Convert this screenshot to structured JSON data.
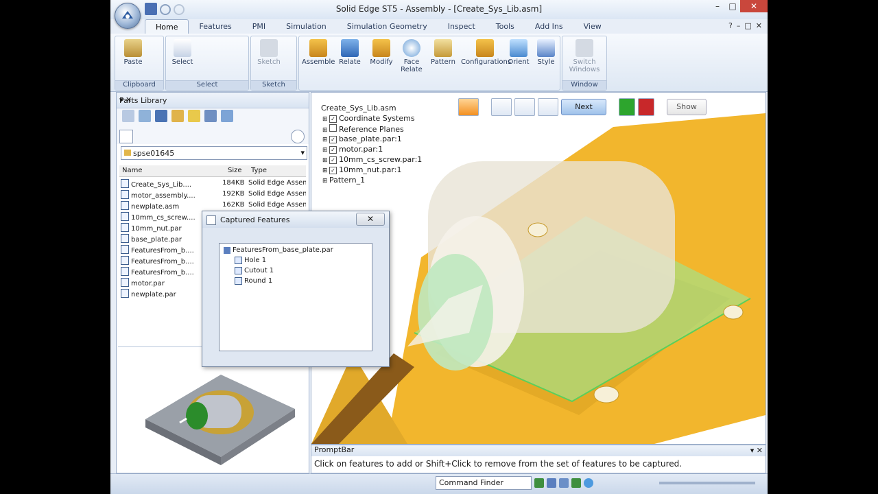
{
  "window": {
    "title": "Solid Edge ST5 - Assembly - [Create_Sys_Lib.asm]",
    "controls": [
      "–",
      "□",
      "✕"
    ]
  },
  "tabs": [
    "Home",
    "Features",
    "PMI",
    "Simulation",
    "Simulation Geometry",
    "Inspect",
    "Tools",
    "Add Ins",
    "View"
  ],
  "ribbon": {
    "groups": [
      "Clipboard",
      "Select",
      "Sketch",
      "Window"
    ],
    "buttons": {
      "paste": "Paste",
      "select": "Select",
      "sketch": "Sketch",
      "assemble": "Assemble",
      "relate": "Relate",
      "modify": "Modify",
      "face_relate": "Face Relate",
      "pattern": "Pattern",
      "configurations": "Configurations",
      "orient": "Orient",
      "style": "Style",
      "switch_windows": "Switch Windows"
    },
    "right_controls": [
      "?",
      "–",
      "□",
      "✕"
    ]
  },
  "parts_library": {
    "title": "Parts Library",
    "folder": "spse01645",
    "columns": {
      "name": "Name",
      "size": "Size",
      "type": "Type"
    },
    "files": [
      {
        "name": "Create_Sys_Lib....",
        "size": "184KB",
        "type": "Solid Edge Assem"
      },
      {
        "name": "motor_assembly....",
        "size": "192KB",
        "type": "Solid Edge Assem"
      },
      {
        "name": "newplate.asm",
        "size": "162KB",
        "type": "Solid Edge Assem"
      },
      {
        "name": "10mm_cs_screw....",
        "size": "",
        "type": ""
      },
      {
        "name": "10mm_nut.par",
        "size": "",
        "type": ""
      },
      {
        "name": "base_plate.par",
        "size": "",
        "type": ""
      },
      {
        "name": "FeaturesFrom_b....",
        "size": "",
        "type": ""
      },
      {
        "name": "FeaturesFrom_b....",
        "size": "",
        "type": ""
      },
      {
        "name": "FeaturesFrom_b....",
        "size": "",
        "type": ""
      },
      {
        "name": "motor.par",
        "size": "",
        "type": ""
      },
      {
        "name": "newplate.par",
        "size": "",
        "type": ""
      }
    ]
  },
  "pathfinder": {
    "items": [
      {
        "label": "Create_Sys_Lib.asm",
        "indent": 0,
        "checked": null
      },
      {
        "label": "Coordinate Systems",
        "indent": 1,
        "checked": true
      },
      {
        "label": "Reference Planes",
        "indent": 1,
        "checked": false
      },
      {
        "label": "base_plate.par:1",
        "indent": 1,
        "checked": true
      },
      {
        "label": "motor.par:1",
        "indent": 1,
        "checked": true
      },
      {
        "label": "10mm_cs_screw.par:1",
        "indent": 1,
        "checked": true
      },
      {
        "label": "10mm_nut.par:1",
        "indent": 1,
        "checked": true
      },
      {
        "label": "Pattern_1",
        "indent": 1,
        "checked": null
      }
    ]
  },
  "command_bar": {
    "next": "Next",
    "show": "Show"
  },
  "dialog": {
    "title": "Captured Features",
    "close": "✕",
    "root": "FeaturesFrom_base_plate.par",
    "items": [
      "Hole 1",
      "Cutout 1",
      "Round 1"
    ]
  },
  "promptbar": {
    "title": "PromptBar",
    "text": "Click on features to add or Shift+Click to remove from the set of features to be captured."
  },
  "status": {
    "command_finder": "Command Finder"
  },
  "colors": {
    "accent": "#f2b62d",
    "selection_green": "#7fe08a",
    "ribbon": "#dde7f3"
  }
}
